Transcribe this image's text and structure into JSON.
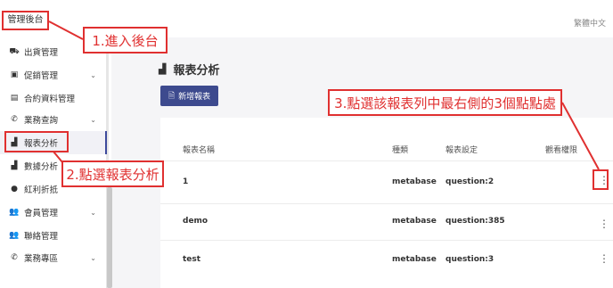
{
  "topbar": {
    "admin_tab": "管理後台",
    "language": "繁體中文"
  },
  "sidebar": {
    "items": [
      {
        "label": "出貨管理",
        "icon": "truck-icon",
        "chevron": false
      },
      {
        "label": "促銷管理",
        "icon": "promo-icon",
        "chevron": true
      },
      {
        "label": "合約資料管理",
        "icon": "document-icon",
        "chevron": false
      },
      {
        "label": "業務查詢",
        "icon": "phone-icon",
        "chevron": true
      },
      {
        "label": "報表分析",
        "icon": "chart-icon",
        "chevron": false,
        "active": true
      },
      {
        "label": "數據分析",
        "icon": "chart-icon",
        "chevron": false
      },
      {
        "label": "紅利折抵",
        "icon": "coin-icon",
        "chevron": false
      },
      {
        "label": "會員管理",
        "icon": "users-icon",
        "chevron": true
      },
      {
        "label": "聯絡管理",
        "icon": "users-icon",
        "chevron": false
      },
      {
        "label": "業務專區",
        "icon": "phone-icon",
        "chevron": true
      }
    ]
  },
  "main": {
    "title": "報表分析",
    "new_button": "新增報表",
    "table": {
      "headers": [
        "報表名稱",
        "種類",
        "報表設定",
        "觀看權限"
      ],
      "rows": [
        [
          "1",
          "metabase",
          "question:2",
          ""
        ],
        [
          "demo",
          "metabase",
          "question:385",
          ""
        ],
        [
          "test",
          "metabase",
          "question:3",
          ""
        ]
      ]
    }
  },
  "callouts": {
    "step1": "1.進入後台",
    "step2": "2.點選報表分析",
    "step3": "3.點選該報表列中最右側的3個點點處"
  },
  "colors": {
    "accent": "#3d4a8e",
    "highlight": "#e03030"
  }
}
